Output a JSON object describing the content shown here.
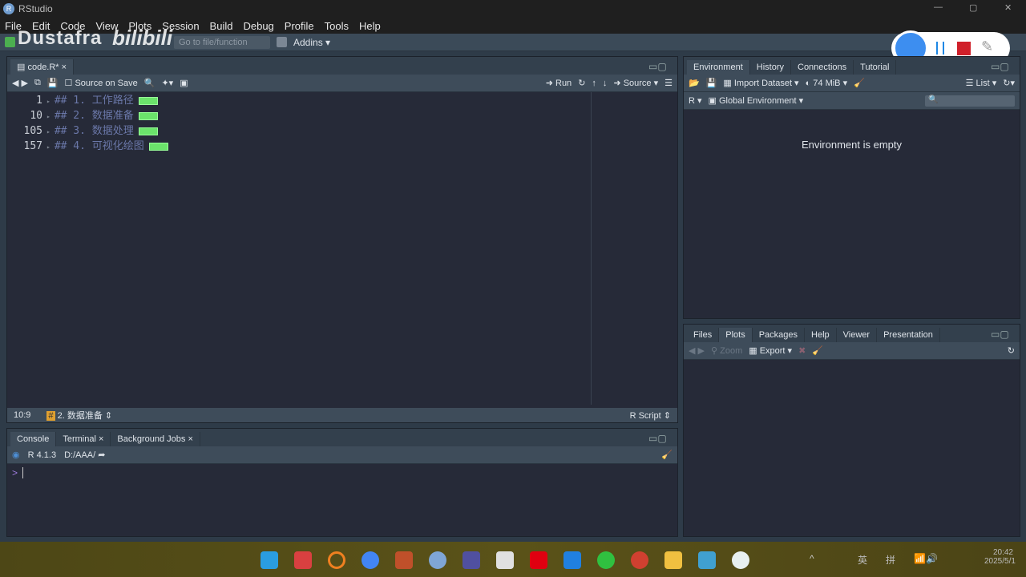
{
  "window": {
    "title": "RStudio"
  },
  "menu": [
    "File",
    "Edit",
    "Code",
    "View",
    "Plots",
    "Session",
    "Build",
    "Debug",
    "Profile",
    "Tools",
    "Help"
  ],
  "toolbar": {
    "goto_placeholder": "Go to file/function",
    "addins": "Addins"
  },
  "watermark": {
    "text": "Dustafra",
    "logo": "bilibili"
  },
  "editor": {
    "tab": "code.R*",
    "source_on_save": "Source on Save",
    "run": "Run",
    "source": "Source",
    "lines": [
      {
        "num": "1",
        "text": "## 1. 工作路径"
      },
      {
        "num": "10",
        "text": "## 2. 数据准备"
      },
      {
        "num": "105",
        "text": "## 3. 数据处理"
      },
      {
        "num": "157",
        "text": "## 4. 可视化绘图"
      }
    ],
    "status": {
      "position": "10:9",
      "section": "2. 数据准备",
      "filetype": "R Script"
    }
  },
  "console": {
    "tabs": [
      "Console",
      "Terminal",
      "Background Jobs"
    ],
    "version": "R 4.1.3",
    "path": "D:/AAA/",
    "prompt": ">"
  },
  "environment": {
    "tabs": [
      "Environment",
      "History",
      "Connections",
      "Tutorial"
    ],
    "import": "Import Dataset",
    "memory": "74 MiB",
    "view": "List",
    "lang": "R",
    "scope": "Global Environment",
    "empty_msg": "Environment is empty"
  },
  "files": {
    "tabs": [
      "Files",
      "Plots",
      "Packages",
      "Help",
      "Viewer",
      "Presentation"
    ],
    "zoom": "Zoom",
    "export": "Export"
  },
  "taskbar": {
    "time": "20:42",
    "date": "2025/5/1",
    "ime1": "英",
    "ime2": "拼"
  },
  "colors": {
    "editor_bg": "#262a38",
    "comment": "#6a77a8",
    "fold_marker": "#6be36b",
    "record_stop": "#d0202a"
  }
}
